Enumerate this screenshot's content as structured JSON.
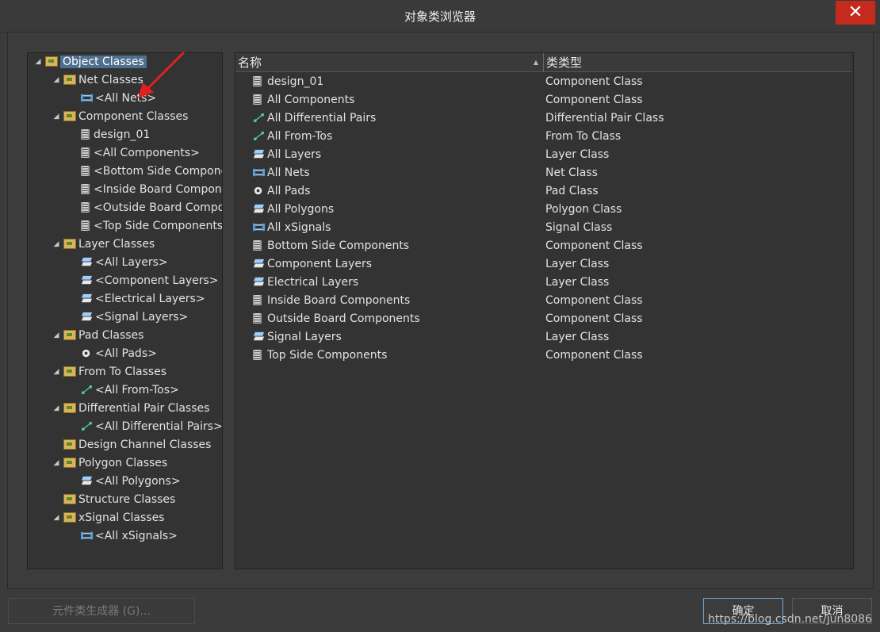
{
  "window": {
    "title": "对象类浏览器",
    "close_glyph": "✕"
  },
  "tree": [
    {
      "label": "Object Classes",
      "level": 0,
      "expander": "◢",
      "icon": "folder",
      "selected": true
    },
    {
      "label": "Net Classes",
      "level": 1,
      "expander": "◢",
      "icon": "folder"
    },
    {
      "label": "<All Nets>",
      "level": 2,
      "expander": "",
      "icon": "net"
    },
    {
      "label": "Component Classes",
      "level": 1,
      "expander": "◢",
      "icon": "folder"
    },
    {
      "label": "design_01",
      "level": 2,
      "expander": "",
      "icon": "component"
    },
    {
      "label": "<All Components>",
      "level": 2,
      "expander": "",
      "icon": "component"
    },
    {
      "label": "<Bottom Side Compone",
      "level": 2,
      "expander": "",
      "icon": "component"
    },
    {
      "label": "<Inside Board Compone",
      "level": 2,
      "expander": "",
      "icon": "component"
    },
    {
      "label": "<Outside Board Compo",
      "level": 2,
      "expander": "",
      "icon": "component"
    },
    {
      "label": "<Top Side Components",
      "level": 2,
      "expander": "",
      "icon": "component"
    },
    {
      "label": "Layer Classes",
      "level": 1,
      "expander": "◢",
      "icon": "folder"
    },
    {
      "label": "<All Layers>",
      "level": 2,
      "expander": "",
      "icon": "layer"
    },
    {
      "label": "<Component Layers>",
      "level": 2,
      "expander": "",
      "icon": "layer"
    },
    {
      "label": "<Electrical Layers>",
      "level": 2,
      "expander": "",
      "icon": "layer"
    },
    {
      "label": "<Signal Layers>",
      "level": 2,
      "expander": "",
      "icon": "layer"
    },
    {
      "label": "Pad Classes",
      "level": 1,
      "expander": "◢",
      "icon": "folder"
    },
    {
      "label": "<All Pads>",
      "level": 2,
      "expander": "",
      "icon": "pad"
    },
    {
      "label": "From To Classes",
      "level": 1,
      "expander": "◢",
      "icon": "folder"
    },
    {
      "label": "<All From-Tos>",
      "level": 2,
      "expander": "",
      "icon": "fromto"
    },
    {
      "label": "Differential Pair Classes",
      "level": 1,
      "expander": "◢",
      "icon": "folder"
    },
    {
      "label": "<All Differential Pairs>",
      "level": 2,
      "expander": "",
      "icon": "fromto"
    },
    {
      "label": "Design Channel Classes",
      "level": 1,
      "expander": "",
      "icon": "folder"
    },
    {
      "label": "Polygon Classes",
      "level": 1,
      "expander": "◢",
      "icon": "folder"
    },
    {
      "label": "<All Polygons>",
      "level": 2,
      "expander": "",
      "icon": "layer"
    },
    {
      "label": "Structure Classes",
      "level": 1,
      "expander": "",
      "icon": "folder"
    },
    {
      "label": "xSignal Classes",
      "level": 1,
      "expander": "◢",
      "icon": "folder"
    },
    {
      "label": "<All xSignals>",
      "level": 2,
      "expander": "",
      "icon": "net"
    }
  ],
  "list": {
    "header_name": "名称",
    "header_type": "类类型",
    "sort_glyph": "▲",
    "rows": [
      {
        "name": "design_01",
        "type": "Component Class",
        "icon": "component"
      },
      {
        "name": "All Components",
        "type": "Component Class",
        "icon": "component"
      },
      {
        "name": "All Differential Pairs",
        "type": "Differential Pair Class",
        "icon": "fromto"
      },
      {
        "name": "All From-Tos",
        "type": "From To Class",
        "icon": "fromto"
      },
      {
        "name": "All Layers",
        "type": "Layer Class",
        "icon": "layer"
      },
      {
        "name": "All Nets",
        "type": "Net Class",
        "icon": "net"
      },
      {
        "name": "All Pads",
        "type": "Pad Class",
        "icon": "pad"
      },
      {
        "name": "All Polygons",
        "type": "Polygon Class",
        "icon": "layer"
      },
      {
        "name": "All xSignals",
        "type": "Signal Class",
        "icon": "net"
      },
      {
        "name": "Bottom Side Components",
        "type": "Component Class",
        "icon": "component"
      },
      {
        "name": "Component Layers",
        "type": "Layer Class",
        "icon": "layer"
      },
      {
        "name": "Electrical Layers",
        "type": "Layer Class",
        "icon": "layer"
      },
      {
        "name": "Inside Board Components",
        "type": "Component Class",
        "icon": "component"
      },
      {
        "name": "Outside Board Components",
        "type": "Component Class",
        "icon": "component"
      },
      {
        "name": "Signal Layers",
        "type": "Layer Class",
        "icon": "layer"
      },
      {
        "name": "Top Side Components",
        "type": "Component Class",
        "icon": "component"
      }
    ]
  },
  "buttons": {
    "generator_label": "元件类生成器 (G)...",
    "ok_label": "确定",
    "cancel_label": "取消"
  },
  "watermark": "https://blog.csdn.net/jun8086",
  "colors": {
    "selection": "#4f6f8f",
    "close": "#c42b1c",
    "annotation_arrow": "#e02020"
  }
}
